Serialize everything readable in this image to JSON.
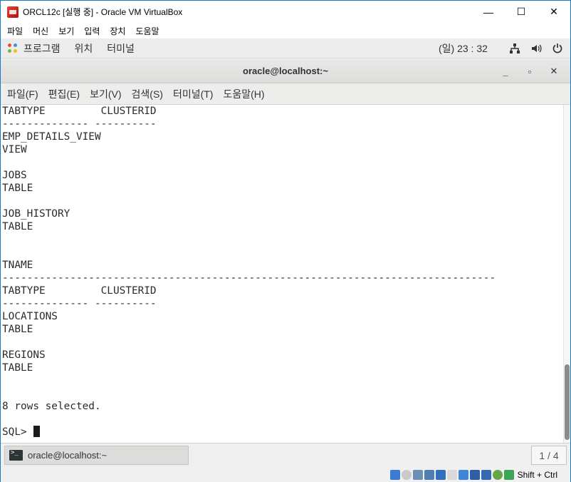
{
  "host_window": {
    "title": "ORCL12c [실행 중] - Oracle VM VirtualBox",
    "controls": {
      "minimize": "—",
      "maximize": "☐",
      "close": "✕"
    },
    "menu": [
      "파일",
      "머신",
      "보기",
      "입력",
      "장치",
      "도움말"
    ]
  },
  "gnome_top": {
    "menu": [
      "프로그램",
      "위치",
      "터미널"
    ],
    "clock": "(일) 23 : 32",
    "tray_icons": [
      "network-icon",
      "volume-icon",
      "power-icon"
    ]
  },
  "terminal": {
    "title": "oracle@localhost:~",
    "controls": {
      "minimize": "_",
      "maximize": "▫",
      "close": "✕"
    },
    "menu": [
      "파일(F)",
      "편집(E)",
      "보기(V)",
      "검색(S)",
      "터미널(T)",
      "도움말(H)"
    ],
    "lines": [
      "TABTYPE         CLUSTERID",
      "-------------- ----------",
      "EMP_DETAILS_VIEW",
      "VIEW",
      "",
      "JOBS",
      "TABLE",
      "",
      "JOB_HISTORY",
      "TABLE",
      "",
      "",
      "TNAME",
      "--------------------------------------------------------------------------------",
      "TABTYPE         CLUSTERID",
      "-------------- ----------",
      "LOCATIONS",
      "TABLE",
      "",
      "REGIONS",
      "TABLE",
      "",
      "",
      "8 rows selected.",
      ""
    ],
    "prompt": "SQL> "
  },
  "taskbar": {
    "item_label": "oracle@localhost:~",
    "workspace": "1 / 4"
  },
  "vbox_status": {
    "hostkey": "Shift + Ctrl"
  }
}
